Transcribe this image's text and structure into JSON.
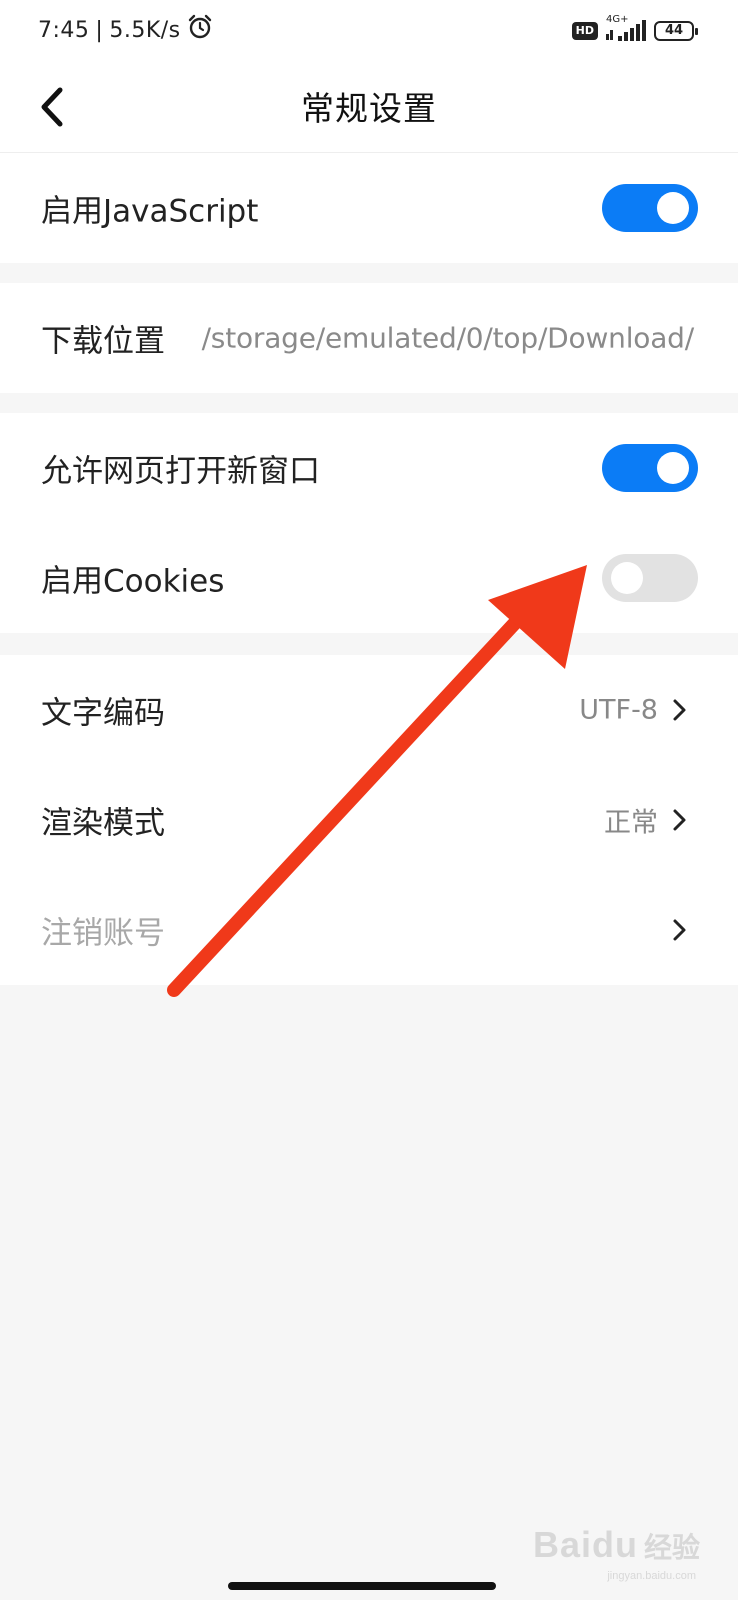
{
  "status_bar": {
    "time": "7:45",
    "separator": "|",
    "net_speed": "5.5K/s",
    "hd_badge": "HD",
    "network_type": "4G+",
    "battery": "44",
    "icons": [
      "alarm-icon",
      "signal-icon",
      "battery-icon"
    ]
  },
  "nav": {
    "title": "常规设置",
    "back_icon": "back-chevron-icon"
  },
  "settings": {
    "javascript": {
      "label": "启用JavaScript",
      "enabled": true
    },
    "download": {
      "label": "下载位置",
      "path": "/storage/emulated/0/top/Download/"
    },
    "new_window": {
      "label": "允许网页打开新窗口",
      "enabled": true
    },
    "cookies": {
      "label": "启用Cookies",
      "enabled": false
    },
    "encoding": {
      "label": "文字编码",
      "value": "UTF-8"
    },
    "render_mode": {
      "label": "渲染模式",
      "value": "正常"
    },
    "logout": {
      "label": "注销账号"
    }
  },
  "watermark": {
    "brand": "Baidu",
    "suffix": "经验",
    "domain": "jingyan.baidu.com"
  },
  "colors": {
    "toggle_on": "#0b7cf6",
    "toggle_off": "#e2e2e2",
    "annotation_arrow": "#f0391a",
    "page_bg": "#f6f6f6"
  }
}
